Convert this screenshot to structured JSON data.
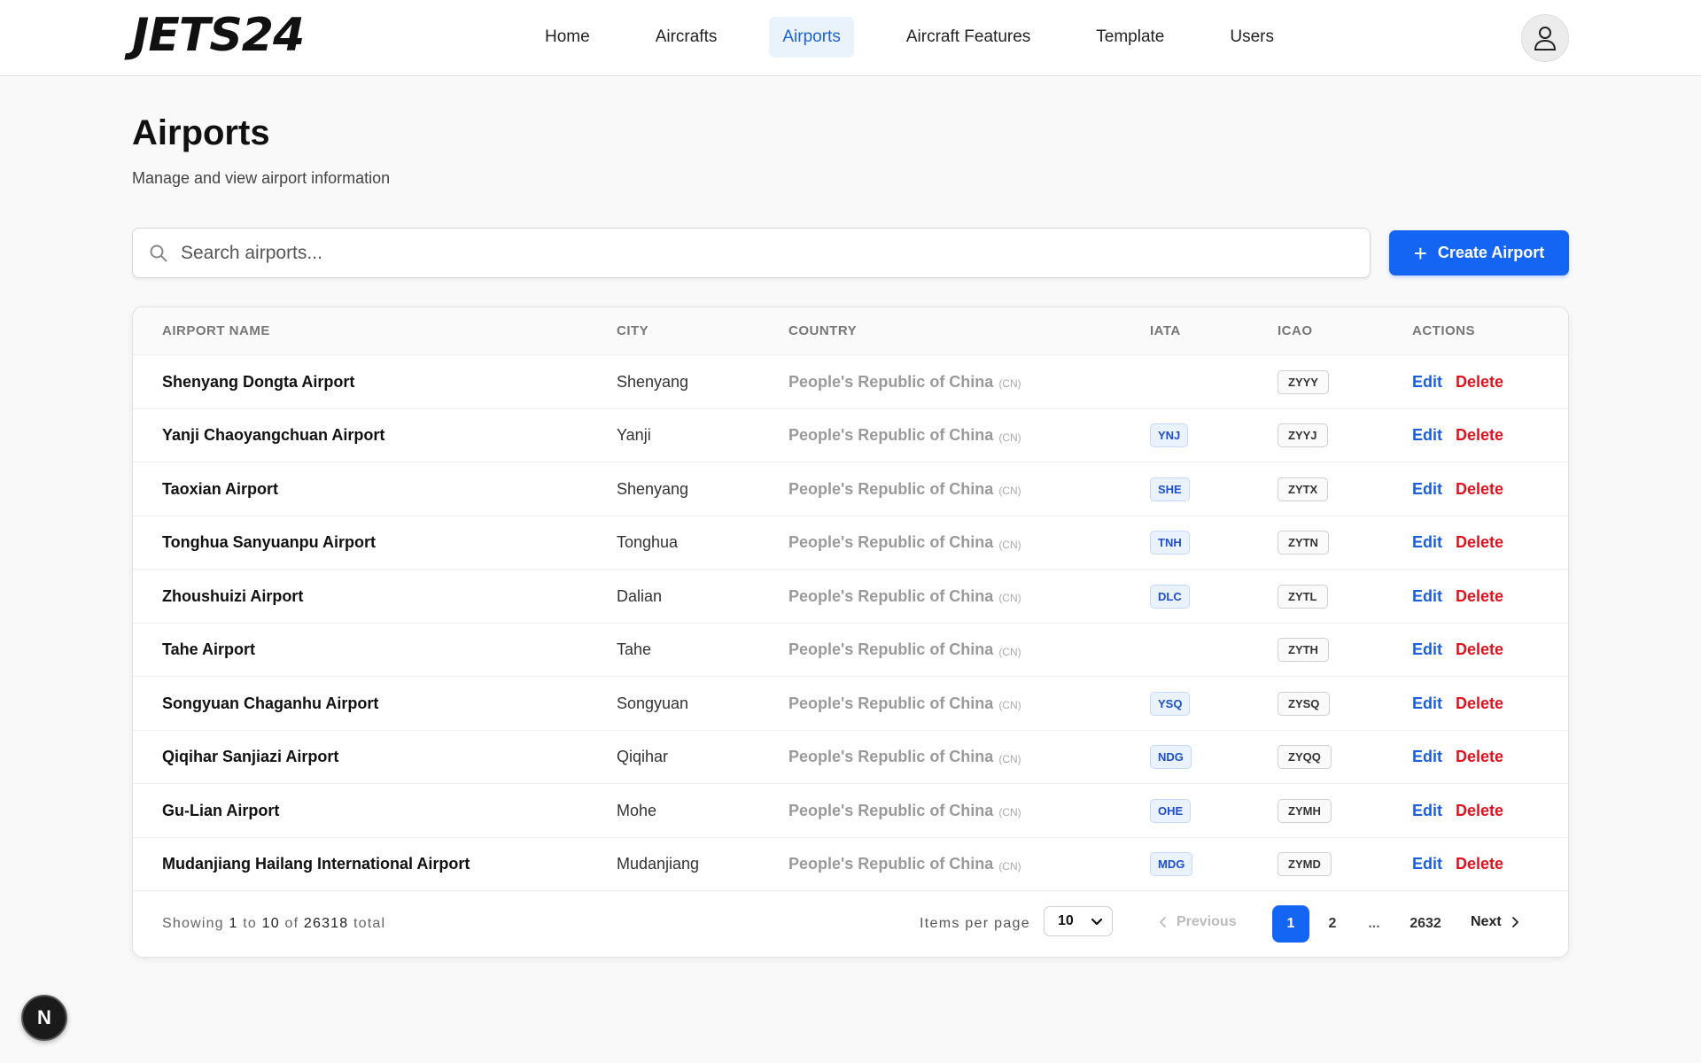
{
  "header": {
    "logo": "JETS24",
    "nav": [
      {
        "label": "Home",
        "active": false
      },
      {
        "label": "Aircrafts",
        "active": false
      },
      {
        "label": "Airports",
        "active": true
      },
      {
        "label": "Aircraft Features",
        "active": false
      },
      {
        "label": "Template",
        "active": false
      },
      {
        "label": "Users",
        "active": false
      }
    ],
    "avatar_icon": "user-icon"
  },
  "page": {
    "title": "Airports",
    "subtitle": "Manage and view airport information"
  },
  "search": {
    "placeholder": "Search airports...",
    "value": ""
  },
  "create_button": {
    "label": "Create Airport",
    "icon": "plus-icon",
    "color": "#1565f5"
  },
  "table": {
    "columns": [
      "AIRPORT NAME",
      "CITY",
      "COUNTRY",
      "IATA",
      "ICAO",
      "ACTIONS"
    ],
    "rows": [
      {
        "name": "Shenyang Dongta Airport",
        "city": "Shenyang",
        "country": "People's Republic of China",
        "country_code": "(CN)",
        "iata": "",
        "icao": "ZYYY"
      },
      {
        "name": "Yanji Chaoyangchuan Airport",
        "city": "Yanji",
        "country": "People's Republic of China",
        "country_code": "(CN)",
        "iata": "YNJ",
        "icao": "ZYYJ"
      },
      {
        "name": "Taoxian Airport",
        "city": "Shenyang",
        "country": "People's Republic of China",
        "country_code": "(CN)",
        "iata": "SHE",
        "icao": "ZYTX"
      },
      {
        "name": "Tonghua Sanyuanpu Airport",
        "city": "Tonghua",
        "country": "People's Republic of China",
        "country_code": "(CN)",
        "iata": "TNH",
        "icao": "ZYTN"
      },
      {
        "name": "Zhoushuizi Airport",
        "city": "Dalian",
        "country": "People's Republic of China",
        "country_code": "(CN)",
        "iata": "DLC",
        "icao": "ZYTL"
      },
      {
        "name": "Tahe Airport",
        "city": "Tahe",
        "country": "People's Republic of China",
        "country_code": "(CN)",
        "iata": "",
        "icao": "ZYTH"
      },
      {
        "name": "Songyuan Chaganhu Airport",
        "city": "Songyuan",
        "country": "People's Republic of China",
        "country_code": "(CN)",
        "iata": "YSQ",
        "icao": "ZYSQ"
      },
      {
        "name": "Qiqihar Sanjiazi Airport",
        "city": "Qiqihar",
        "country": "People's Republic of China",
        "country_code": "(CN)",
        "iata": "NDG",
        "icao": "ZYQQ"
      },
      {
        "name": "Gu-Lian Airport",
        "city": "Mohe",
        "country": "People's Republic of China",
        "country_code": "(CN)",
        "iata": "OHE",
        "icao": "ZYMH"
      },
      {
        "name": "Mudanjiang Hailang International Airport",
        "city": "Mudanjiang",
        "country": "People's Republic of China",
        "country_code": "(CN)",
        "iata": "MDG",
        "icao": "ZYMD"
      }
    ],
    "edit_label": "Edit",
    "delete_label": "Delete",
    "edit_color": "#1a5fe0",
    "delete_color": "#e0121e"
  },
  "footer": {
    "showing_prefix": "Showing",
    "showing_from": "1",
    "showing_to_word": "to",
    "showing_to": "10",
    "showing_of_word": "of",
    "showing_total": "26318",
    "showing_suffix": "total",
    "items_per_page_label": "Items per page",
    "items_per_page_value": "10",
    "previous_label": "Previous",
    "pages": [
      "1",
      "2",
      "...",
      "2632"
    ],
    "current_page": "1",
    "next_label": "Next"
  },
  "floating_badge": {
    "label": "N"
  }
}
